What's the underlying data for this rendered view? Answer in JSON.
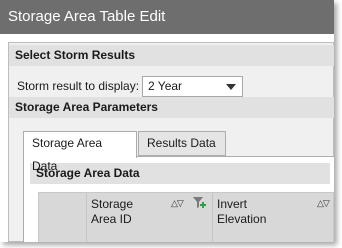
{
  "window": {
    "title": "Storage Area Table Edit"
  },
  "storm_results": {
    "header": "Select Storm Results",
    "label": "Storm result to display:",
    "selected": "2 Year"
  },
  "parameters": {
    "header": "Storage Area Parameters"
  },
  "tabs": [
    {
      "label": "Storage Area Data",
      "active": true
    },
    {
      "label": "Results Data",
      "active": false
    }
  ],
  "panel": {
    "header": "Storage Area Data",
    "columns": [
      {
        "label_line1": "Storage",
        "label_line2": "Area ID"
      },
      {
        "label_line1": "Invert",
        "label_line2": "Elevation"
      }
    ]
  },
  "icons": {
    "sort": "sort-asc-desc-icon",
    "filter": "filter-add-icon"
  },
  "colors": {
    "titlebar": "#6e6e6e",
    "section_header": "#e1e1e1",
    "filter_plus": "#2ea043"
  }
}
